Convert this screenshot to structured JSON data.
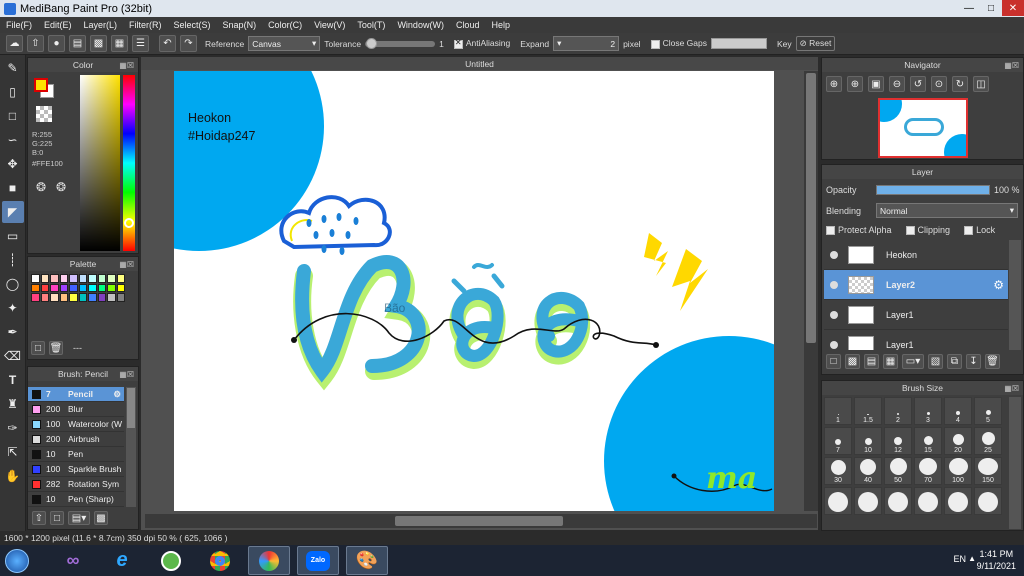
{
  "window": {
    "title": "MediBang Paint Pro (32bit)"
  },
  "menu": [
    "File(F)",
    "Edit(E)",
    "Layer(L)",
    "Filter(R)",
    "Select(S)",
    "Snap(N)",
    "Color(C)",
    "View(V)",
    "Tool(T)",
    "Window(W)",
    "Cloud",
    "Help"
  ],
  "toolbar": {
    "reference_label": "Reference",
    "reference_value": "Canvas",
    "tolerance_label": "Tolerance",
    "tolerance_value": "1",
    "tolerance_level": 0.02,
    "antialiasing_label": "AntiAliasing",
    "antialiasing_checked": true,
    "expand_label": "Expand",
    "expand_value": "2",
    "expand_unit": "pixel",
    "close_gaps_label": "Close Gaps",
    "close_gaps_checked": false,
    "key_label": "Key",
    "reset_label": "Reset"
  },
  "color_panel": {
    "title": "Color",
    "r": "R:255",
    "g": "G:225",
    "b": "B:0",
    "hex": "#FFE100",
    "fg_color": "#ffe100",
    "bg_color": "#ffffff"
  },
  "palette_panel": {
    "title": "Palette",
    "label": "---",
    "swatches": [
      "#ffffff",
      "#ffe3c0",
      "#ffc0c0",
      "#ffd0f0",
      "#d0c0ff",
      "#c0e0ff",
      "#c0ffff",
      "#c0ffd0",
      "#e0ffc0",
      "#ffff80",
      "#ff8000",
      "#ff4040",
      "#ff40c0",
      "#a040ff",
      "#4060ff",
      "#00c0ff",
      "#00ffff",
      "#00ff80",
      "#80ff00",
      "#ffff00",
      "#ff4080",
      "#ff8080",
      "#ffe0c0",
      "#ffc080",
      "#ffff40",
      "#00c0c0",
      "#4080ff",
      "#8040c0",
      "#c0c0c0",
      "#808080"
    ]
  },
  "brush_panel": {
    "title": "Brush: Pencil",
    "items": [
      {
        "size": "7",
        "name": "Pencil",
        "color": "#111111",
        "selected": true
      },
      {
        "size": "200",
        "name": "Blur",
        "color": "#ff9ff0",
        "selected": false
      },
      {
        "size": "100",
        "name": "Watercolor (W",
        "color": "#8ad8ff",
        "selected": false
      },
      {
        "size": "200",
        "name": "Airbrush",
        "color": "#dddddd",
        "selected": false
      },
      {
        "size": "10",
        "name": "Pen",
        "color": "#111111",
        "selected": false
      },
      {
        "size": "100",
        "name": "Sparkle Brush",
        "color": "#3040ff",
        "selected": false
      },
      {
        "size": "282",
        "name": "Rotation Sym",
        "color": "#ff3030",
        "selected": false
      },
      {
        "size": "10",
        "name": "Pen (Sharp)",
        "color": "#111111",
        "selected": false
      }
    ]
  },
  "canvas": {
    "tab": "Untitled",
    "watermark_line1": "Heokon",
    "watermark_line2": "#Hoidap247",
    "word": "Bão",
    "signature": "ma"
  },
  "navigator": {
    "title": "Navigator"
  },
  "layer_panel": {
    "title": "Layer",
    "opacity_label": "Opacity",
    "opacity_value": "100 %",
    "opacity_level": 1.0,
    "blending_label": "Blending",
    "blending_value": "Normal",
    "protect_alpha_label": "Protect Alpha",
    "clipping_label": "Clipping",
    "lock_label": "Lock",
    "layers": [
      {
        "name": "Heokon",
        "selected": false
      },
      {
        "name": "Layer2",
        "selected": true
      },
      {
        "name": "Layer1",
        "selected": false
      },
      {
        "name": "Layer1",
        "selected": false
      }
    ]
  },
  "brush_size_panel": {
    "title": "Brush Size",
    "sizes": [
      "1",
      "1.5",
      "2",
      "3",
      "4",
      "5",
      "7",
      "10",
      "12",
      "15",
      "20",
      "25",
      "30",
      "40",
      "50",
      "70",
      "100",
      "150",
      "",
      "",
      "",
      "",
      "",
      ""
    ]
  },
  "status": {
    "dimensions": "1600 * 1200 pixel",
    "physical": "(11.6 * 8.7cm)",
    "dpi": "350 dpi",
    "zoom": "50 %",
    "coords": "( 625, 1066 )"
  },
  "taskbar": {
    "language": "EN",
    "time": "1:41 PM",
    "date": "9/11/2021",
    "zalo_label": "Zalo"
  }
}
